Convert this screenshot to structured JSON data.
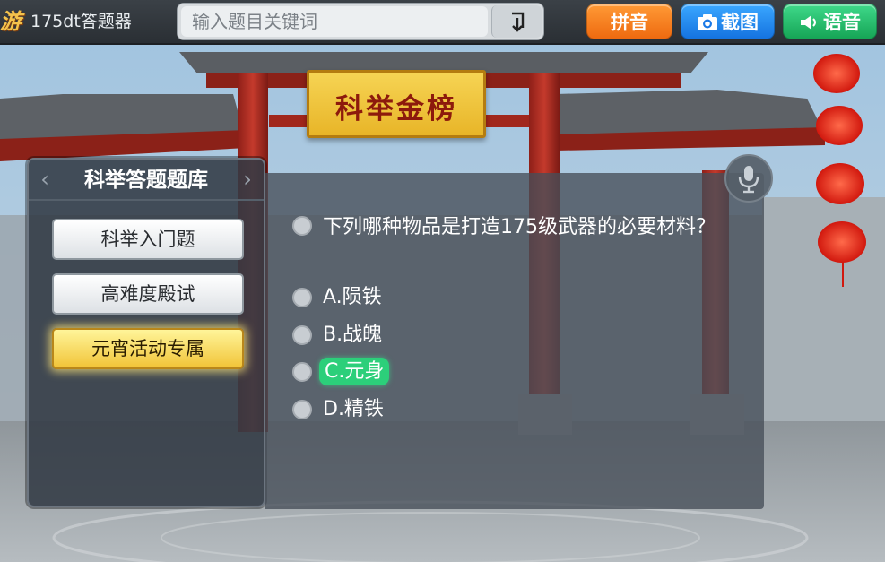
{
  "header": {
    "logo_text": "游",
    "app_title": "175dt答题器",
    "search_placeholder": "输入题目关键词",
    "pinyin_label": "拼音",
    "screenshot_label": "截图",
    "voice_label": "语音"
  },
  "banner": {
    "text": "科举金榜"
  },
  "sidebar": {
    "title": "科举答题题库",
    "categories": [
      {
        "label": "科举入门题",
        "selected": false
      },
      {
        "label": "高难度殿试",
        "selected": false
      },
      {
        "label": "元宵活动专属",
        "selected": true
      }
    ]
  },
  "question": {
    "text": "下列哪种物品是打造175级武器的必要材料？",
    "options": [
      {
        "label": "A.陨铁",
        "correct": false
      },
      {
        "label": "B.战魄",
        "correct": false
      },
      {
        "label": "C.元身",
        "correct": true
      },
      {
        "label": "D.精铁",
        "correct": false
      }
    ]
  },
  "colors": {
    "accent_correct": "#2ccf7a",
    "pinyin_button": "#f07a1c",
    "screenshot_button": "#2186ef",
    "voice_button": "#22b865",
    "selected_category": "#f4d050"
  }
}
